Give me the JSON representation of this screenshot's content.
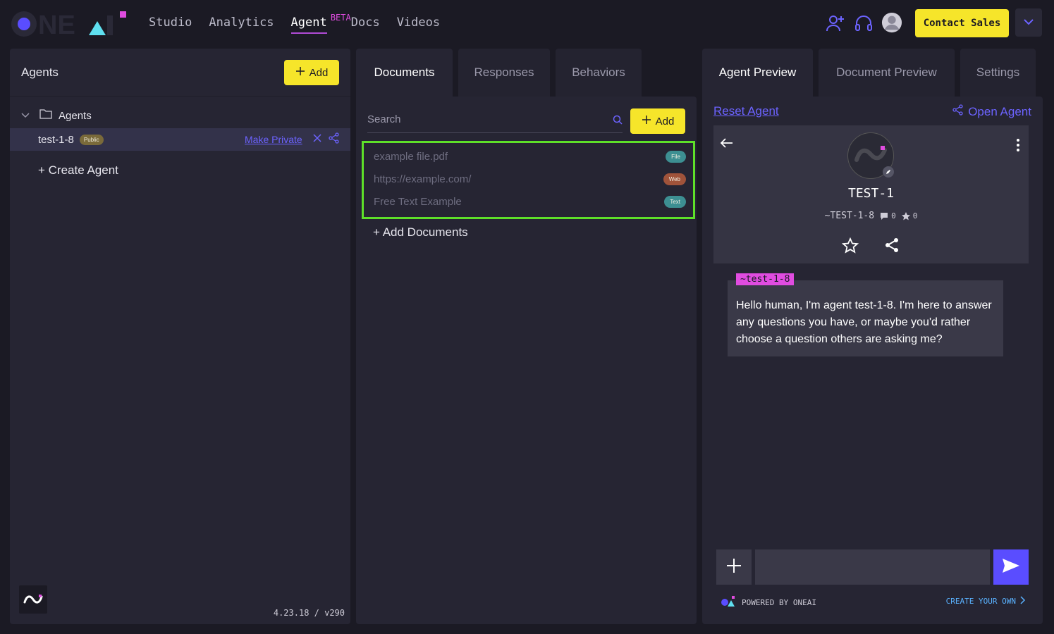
{
  "brand": {
    "name": "ONEAI",
    "colors": {
      "accent": "#6c63ff",
      "yellow": "#f6e52a",
      "magenta": "#e04ce0",
      "green_outline": "#5ee029"
    }
  },
  "nav": {
    "items": [
      {
        "label": "Studio"
      },
      {
        "label": "Analytics"
      },
      {
        "label": "Agent",
        "sup": "BETA",
        "active": true
      },
      {
        "label": "Docs"
      },
      {
        "label": "Videos"
      }
    ],
    "contact_label": "Contact Sales",
    "icons": [
      "add-user-icon",
      "headset-icon",
      "user-avatar-icon",
      "chevron-down-icon"
    ]
  },
  "left": {
    "title": "Agents",
    "add_label": "Add",
    "folder_label": "Agents",
    "agent": {
      "name": "test-1-8",
      "badge": "Public",
      "make_private": "Make Private"
    },
    "create_label": "+ Create Agent",
    "version": "4.23.18 / v290"
  },
  "middle": {
    "tabs": [
      {
        "label": "Documents",
        "active": true
      },
      {
        "label": "Responses"
      },
      {
        "label": "Behaviors"
      }
    ],
    "search_placeholder": "Search",
    "add_label": "Add",
    "documents": [
      {
        "name": "example file.pdf",
        "type": "File"
      },
      {
        "name": "https://example.com/",
        "type": "Web"
      },
      {
        "name": "Free Text Example",
        "type": "Text"
      }
    ],
    "add_docs_label": "+ Add Documents"
  },
  "right": {
    "tabs": [
      {
        "label": "Agent Preview",
        "active": true
      },
      {
        "label": "Document Preview"
      },
      {
        "label": "Settings"
      }
    ],
    "reset_label": "Reset Agent",
    "open_label": "Open Agent",
    "preview": {
      "title": "TEST-1",
      "handle": "~TEST-1-8",
      "comments": "0",
      "stars": "0"
    },
    "message": {
      "tag": "~test-1-8",
      "text": "Hello human, I'm agent test-1-8. I'm here to answer any questions you have, or maybe you'd rather choose a question others are asking me?"
    },
    "powered_by": "POWERED BY ONEAI",
    "create_own": "CREATE YOUR OWN"
  }
}
